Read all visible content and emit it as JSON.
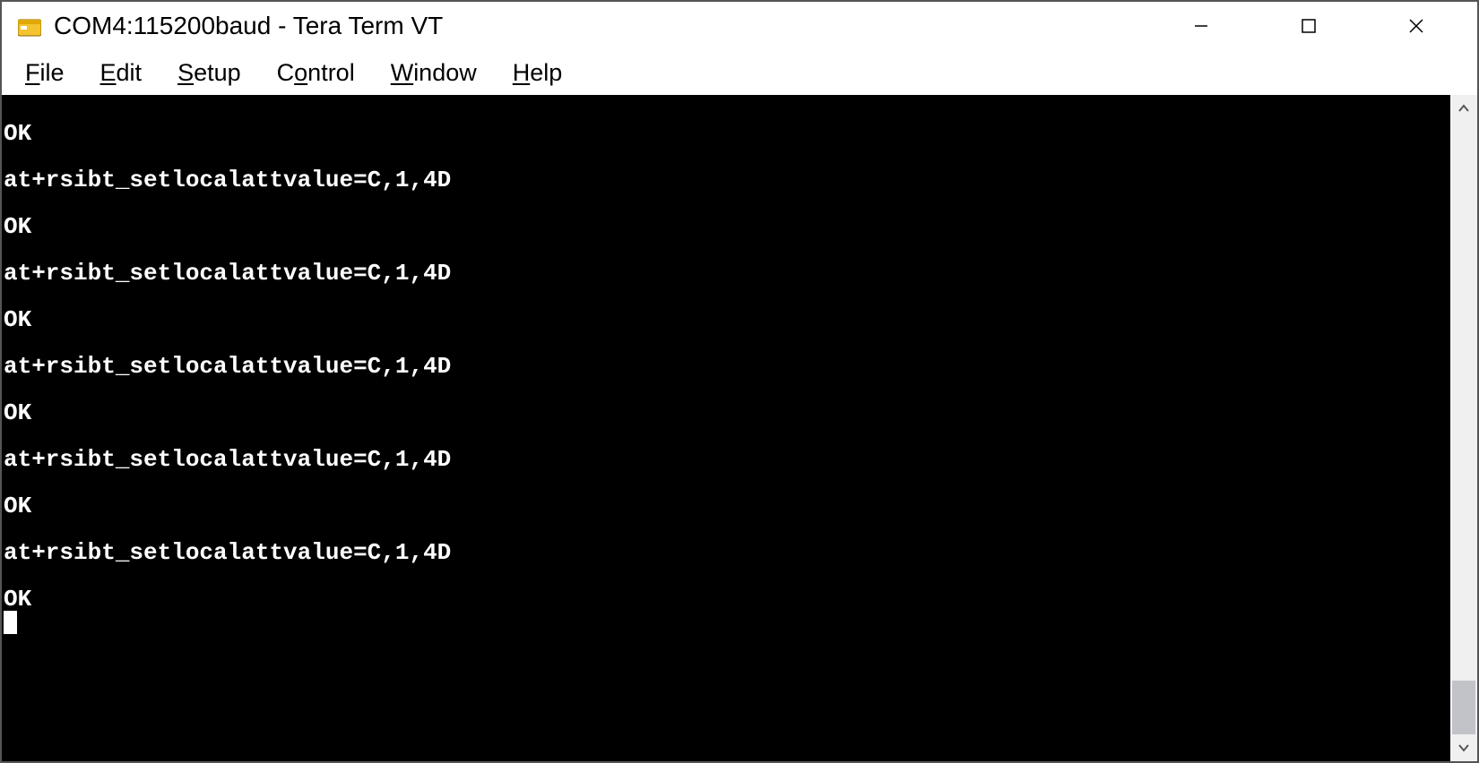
{
  "window": {
    "title": "COM4:115200baud - Tera Term VT"
  },
  "menubar": {
    "items": [
      {
        "label": "File",
        "mnemonic_index": 0
      },
      {
        "label": "Edit",
        "mnemonic_index": 0
      },
      {
        "label": "Setup",
        "mnemonic_index": 0
      },
      {
        "label": "Control",
        "mnemonic_index": 1
      },
      {
        "label": "Window",
        "mnemonic_index": 0
      },
      {
        "label": "Help",
        "mnemonic_index": 0
      }
    ]
  },
  "terminal": {
    "lines": [
      "",
      "OK",
      "",
      "at+rsibt_setlocalattvalue=C,1,4D",
      "",
      "OK",
      "",
      "at+rsibt_setlocalattvalue=C,1,4D",
      "",
      "OK",
      "",
      "at+rsibt_setlocalattvalue=C,1,4D",
      "",
      "OK",
      "",
      "at+rsibt_setlocalattvalue=C,1,4D",
      "",
      "OK",
      "",
      "at+rsibt_setlocalattvalue=C,1,4D",
      "",
      "OK"
    ]
  },
  "icons": {
    "app": "terminal-app-icon",
    "minimize": "minimize-icon",
    "maximize": "maximize-icon",
    "close": "close-icon",
    "scroll_up": "scroll-up-arrow-icon",
    "scroll_down": "scroll-down-arrow-icon"
  }
}
